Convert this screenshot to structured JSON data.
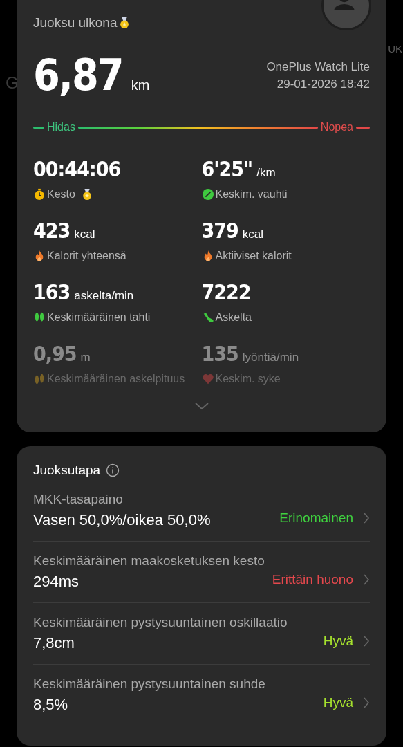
{
  "background_texts": [
    "G",
    "UK"
  ],
  "workout": {
    "title": "Juoksu ulkona",
    "title_medal": true,
    "distance": "6,87",
    "distance_unit": "km",
    "device": "OnePlus Watch Lite",
    "datetime": "29-01-2026 18:42",
    "pace_scale": {
      "slow": "Hidas",
      "fast": "Nopea"
    },
    "metrics": [
      {
        "value": "00:44:06",
        "label": "Kesto",
        "kind": "duration",
        "medal": true,
        "faded": false
      },
      {
        "value": "6'25\"",
        "unit": "/km",
        "label": "Keskim. vauhti",
        "kind": "pace",
        "medal": false,
        "faded": false
      },
      {
        "value": "423",
        "unit": "kcal",
        "label": "Kalorit yhteensä",
        "kind": "calories",
        "medal": false,
        "faded": false
      },
      {
        "value": "379",
        "unit": "kcal",
        "label": "Aktiiviset kalorit",
        "kind": "calories",
        "medal": false,
        "faded": false
      },
      {
        "value": "163",
        "unit": "askelta/min",
        "label": "Keskimääräinen tahti",
        "kind": "cadence",
        "medal": false,
        "faded": false
      },
      {
        "value": "7222",
        "label": "Askelta",
        "kind": "steps",
        "medal": false,
        "faded": false
      },
      {
        "value": "0,95",
        "unit": "m",
        "label": "Keskimääräinen askelpituus",
        "kind": "stride",
        "medal": false,
        "faded": true
      },
      {
        "value": "135",
        "unit": "lyöntiä/min",
        "label": "Keskim. syke",
        "kind": "heart_rate",
        "medal": false,
        "faded": true
      }
    ]
  },
  "running_form": {
    "title": "Juoksutapa",
    "items": [
      {
        "label": "MKK-tasapaino",
        "value": "Vasen 50,0%/oikea 50,0%",
        "rating": "Erinomainen",
        "color": "#3fd23f"
      },
      {
        "label": "Keskimääräinen maakosketuksen kesto",
        "value": "294ms",
        "rating": "Erittäin huono",
        "color": "#e5484d"
      },
      {
        "label": "Keskimääräinen pystysuuntainen oskillaatio",
        "value": "7,8cm",
        "rating": "Hyvä",
        "color": "#a6e22e"
      },
      {
        "label": "Keskimääräinen pystysuuntainen suhde",
        "value": "8,5%",
        "rating": "Hyvä",
        "color": "#a6e22e"
      }
    ]
  }
}
